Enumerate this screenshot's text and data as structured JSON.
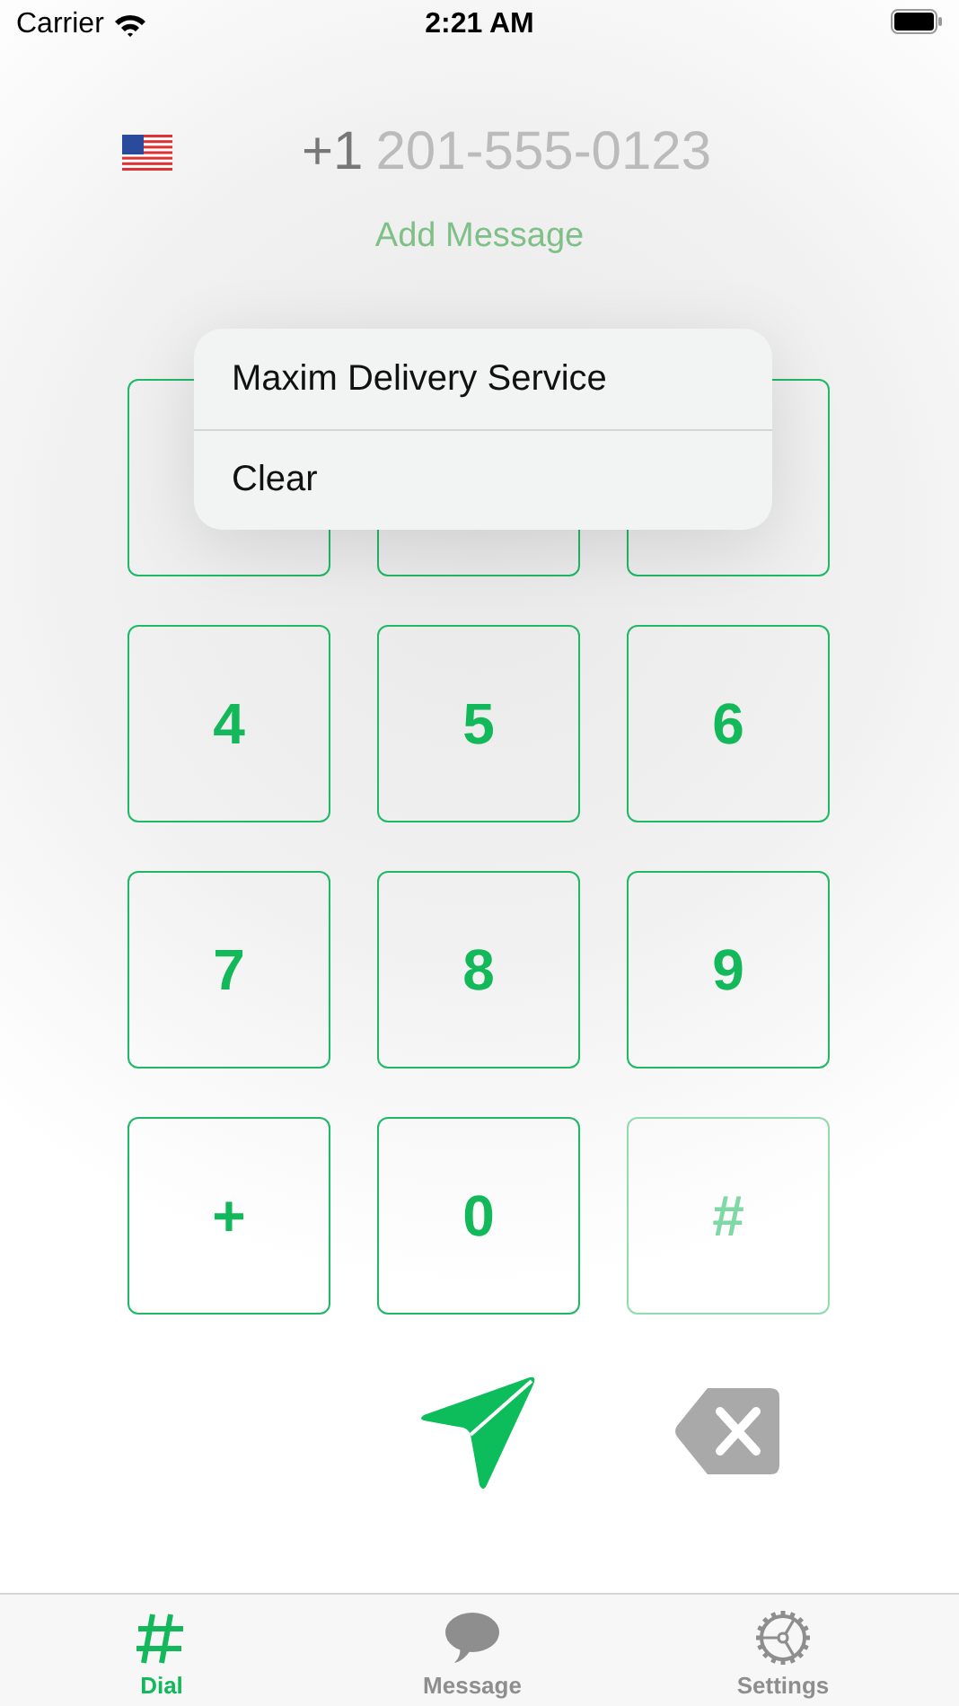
{
  "status_bar": {
    "carrier": "Carrier",
    "time": "2:21 AM"
  },
  "phone": {
    "country_code": "+1",
    "placeholder": "201-555-0123"
  },
  "add_message": "Add Message",
  "context_menu": {
    "items": [
      "Maxim Delivery Service",
      "Clear"
    ]
  },
  "keypad": {
    "keys": [
      {
        "disabled": false
      },
      {
        "disabled": false
      },
      {
        "disabled": false
      },
      {
        "label": "4",
        "disabled": false
      },
      {
        "label": "5",
        "disabled": false
      },
      {
        "label": "6",
        "disabled": false
      },
      {
        "label": "7",
        "disabled": false
      },
      {
        "label": "8",
        "disabled": false
      },
      {
        "label": "9",
        "disabled": false
      },
      {
        "label": "+",
        "disabled": false
      },
      {
        "label": "0",
        "disabled": false
      },
      {
        "label": "#",
        "disabled": true
      }
    ]
  },
  "tabs": [
    {
      "label": "Dial",
      "selected": true
    },
    {
      "label": "Message",
      "selected": false
    },
    {
      "label": "Settings",
      "selected": false
    }
  ]
}
